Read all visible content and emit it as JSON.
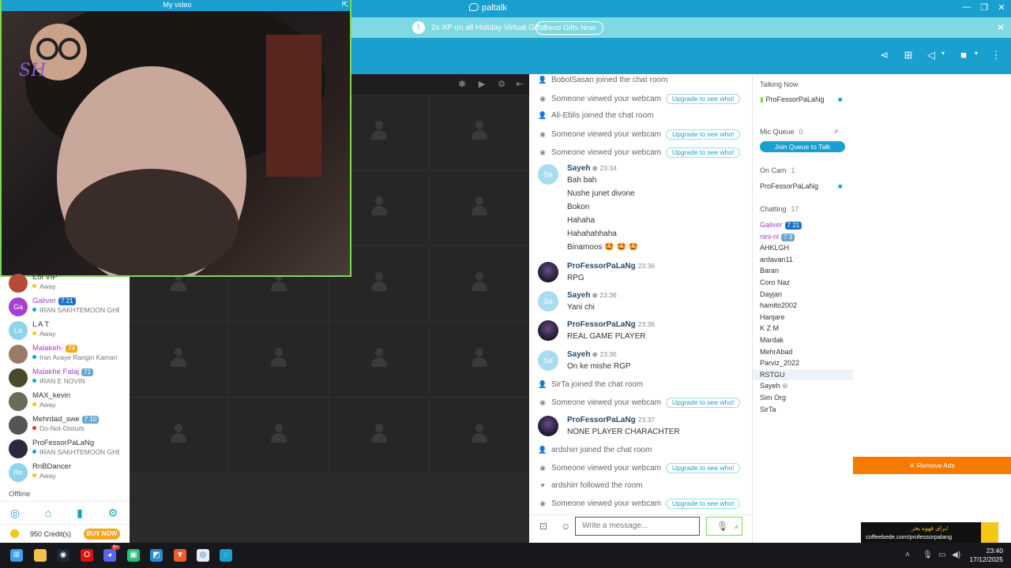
{
  "app": {
    "brand": "paltalk",
    "my_video_title": "My video"
  },
  "promo": {
    "text": "2x XP on all Holiday Virtual Gifts!",
    "button": "Send Gifts Now"
  },
  "sidebar": {
    "users": [
      {
        "name": "Eol VIP",
        "status": "Away",
        "initials": "",
        "color": "#b84a3a",
        "level": ""
      },
      {
        "name": "Galiver",
        "status": "IRAN SAKHTEMOON GHE",
        "initials": "Ga",
        "color": "#a63fd0",
        "level": "7 21"
      },
      {
        "name": "L A T",
        "status": "Away",
        "initials": "La",
        "color": "#8dd5ec",
        "level": ""
      },
      {
        "name": "Malakeh-",
        "status": "Iran Avaye Rangin Kaman",
        "initials": "",
        "color": "#9b7a6a",
        "level": "74"
      },
      {
        "name": "Malakhe Falaj",
        "status": "IRAN E NOVIN",
        "initials": "",
        "color": "#4a4a2a",
        "level": "71"
      },
      {
        "name": "MAX_kevin",
        "status": "Away",
        "initials": "",
        "color": "#6b6b5a",
        "level": ""
      },
      {
        "name": "Mehrdad_swe",
        "status": "Do-Not-Disturb",
        "initials": "",
        "color": "#555",
        "level": "7 10"
      },
      {
        "name": "ProFessorPaLaNg",
        "status": "IRAN SAKHTEMOON GHE",
        "initials": "",
        "color": "#2a2a3a",
        "level": ""
      },
      {
        "name": "RnBDancer",
        "status": "Away",
        "initials": "Rn",
        "color": "#8dd5ec",
        "level": ""
      }
    ],
    "offline_label": "Offline",
    "credits": "950 Credit(s)",
    "buy_now": "BUY NOW"
  },
  "chat": {
    "upgrade_label": "Upgrade to see who!",
    "events": [
      {
        "text": "BobolSasan joined the chat room",
        "icon": "person-icon",
        "upgrade": false
      },
      {
        "text": "Someone viewed your webcam",
        "icon": "eye-icon",
        "upgrade": true
      },
      {
        "text": "Ali-Eblis joined the chat room",
        "icon": "person-icon",
        "upgrade": false
      },
      {
        "text": "Someone viewed your webcam",
        "icon": "eye-icon",
        "upgrade": true
      },
      {
        "text": "Someone viewed your webcam",
        "icon": "eye-icon",
        "upgrade": true
      }
    ],
    "sayeh1": {
      "name": "Sayeh",
      "time": "23:34",
      "initials": "Sa",
      "lines": [
        "Bah bah",
        "Nushe junet divone",
        "Bokon",
        "Hahaha",
        "Hahahahhaha",
        "Binamoos 🤩 🤩 🤩"
      ]
    },
    "pro1": {
      "name": "ProFessorPaLaNg",
      "time": "23:36",
      "line": "RPG"
    },
    "sayeh2": {
      "name": "Sayeh",
      "time": "23:36",
      "initials": "Sa",
      "line": "Yani chi"
    },
    "pro2": {
      "name": "ProFessorPaLaNg",
      "time": "23:36",
      "line": "REAL GAME PLAYER"
    },
    "sayeh3": {
      "name": "Sayeh",
      "time": "23:36",
      "initials": "Sa",
      "line": "On ke mishe RGP"
    },
    "events2": [
      {
        "text": "SirTa joined the chat room",
        "icon": "person-icon",
        "upgrade": false
      },
      {
        "text": "Someone viewed your webcam",
        "icon": "eye-icon",
        "upgrade": true
      }
    ],
    "pro3": {
      "name": "ProFessorPaLaNg",
      "time": "23:37",
      "line": "NONE PLAYER CHARACHTER"
    },
    "events3": [
      {
        "text": "ardshirr joined the chat room",
        "icon": "person-icon",
        "upgrade": false
      },
      {
        "text": "Someone viewed your webcam",
        "icon": "eye-icon",
        "upgrade": true
      },
      {
        "text": "ardshirr followed the room",
        "icon": "heart-icon",
        "upgrade": false
      },
      {
        "text": "Someone viewed your webcam",
        "icon": "eye-icon",
        "upgrade": true
      }
    ],
    "composer_placeholder": "Write a message..."
  },
  "userlist": {
    "talking_now": "Talking Now",
    "talker": "ProFessorPaLaNg",
    "mic_queue": "Mic Queue",
    "mic_queue_count": "0",
    "join_queue": "Join Queue to Talk",
    "on_cam": "On Cam",
    "on_cam_count": "1",
    "on_cam_user": "ProFessorPaLaNg",
    "chatting": "Chatting",
    "chatting_count": "17",
    "chatting_users": [
      {
        "name": "Galiver",
        "level": "7 21",
        "color": "#a63fd0"
      },
      {
        "name": "nini-nl",
        "level": "7 3",
        "color": "#a63fd0"
      },
      {
        "name": "AHKLGH",
        "level": "",
        "color": "#333"
      },
      {
        "name": "ardavan11",
        "level": "",
        "color": "#333"
      },
      {
        "name": "Baran",
        "level": "",
        "color": "#333"
      },
      {
        "name": "Coro Naz",
        "level": "",
        "color": "#333"
      },
      {
        "name": "Dayjan",
        "level": "",
        "color": "#333"
      },
      {
        "name": "hamito2002",
        "level": "",
        "color": "#333"
      },
      {
        "name": "Hanjare",
        "level": "",
        "color": "#333"
      },
      {
        "name": "K Z M",
        "level": "",
        "color": "#333"
      },
      {
        "name": "Mardak",
        "level": "",
        "color": "#333"
      },
      {
        "name": "MehrAbad",
        "level": "",
        "color": "#333"
      },
      {
        "name": "Parviz_2022",
        "level": "",
        "color": "#333"
      },
      {
        "name": "RSTGU",
        "level": "",
        "color": "#333"
      },
      {
        "name": "Sayeh",
        "level": "",
        "color": "#333"
      },
      {
        "name": "Sim Org",
        "level": "",
        "color": "#333"
      },
      {
        "name": "SirTa",
        "level": "",
        "color": "#333"
      }
    ]
  },
  "ads": {
    "remove_ads": "✕ Remove Ads",
    "banner_line1": "برای قهوه بخر!",
    "banner_line2": "coffeebede.com/professorpalang"
  },
  "taskbar": {
    "time": "23:40",
    "date": "17/12/2025",
    "discord_badge": "9+"
  }
}
